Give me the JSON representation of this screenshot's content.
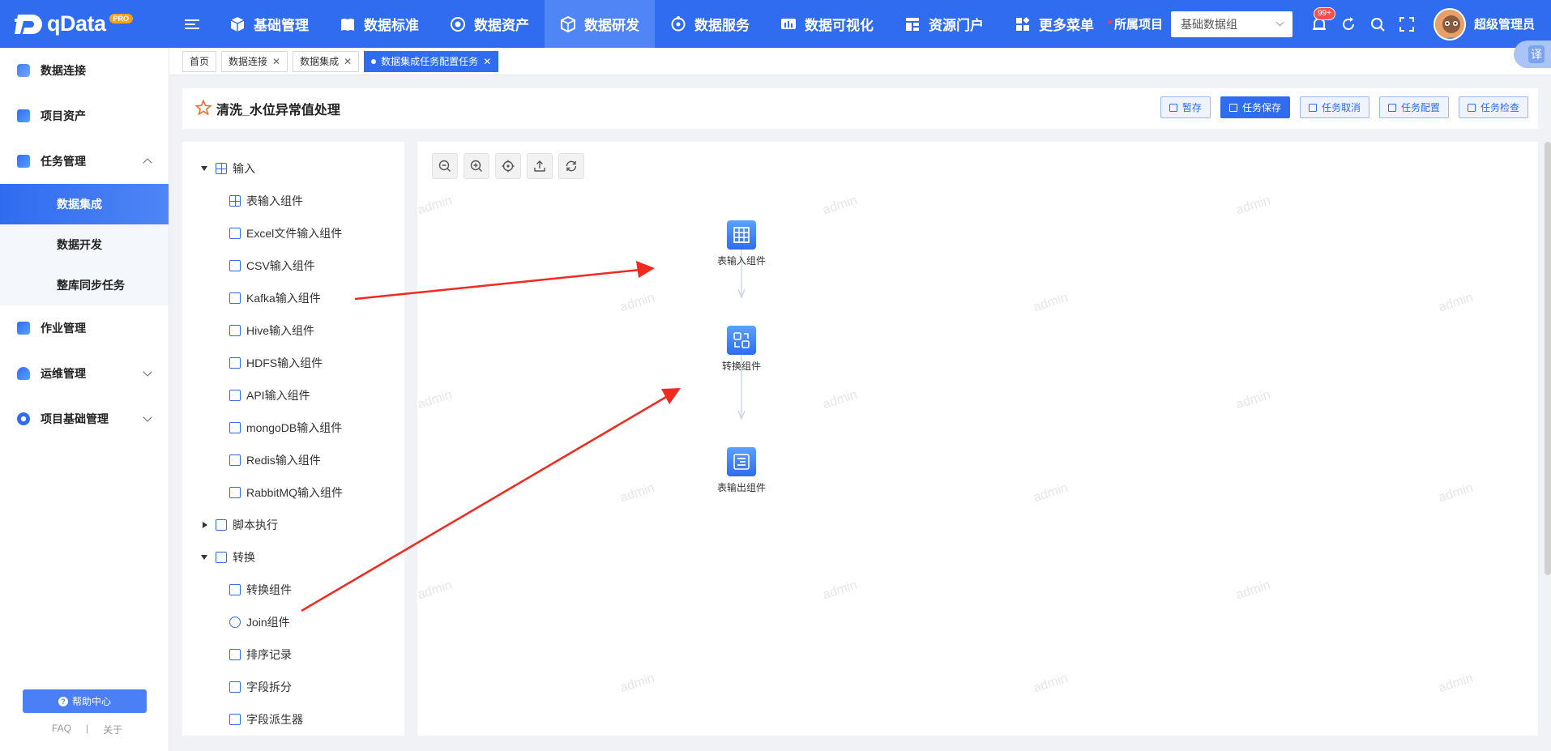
{
  "brand": {
    "name": "qData",
    "tag": "PRO"
  },
  "topnav": {
    "items": [
      {
        "label": "基础管理",
        "icon": "cube-icon"
      },
      {
        "label": "数据标准",
        "icon": "book-icon"
      },
      {
        "label": "数据资产",
        "icon": "target-icon"
      },
      {
        "label": "数据研发",
        "icon": "box-icon",
        "active": true
      },
      {
        "label": "数据服务",
        "icon": "service-icon"
      },
      {
        "label": "数据可视化",
        "icon": "chart-icon"
      },
      {
        "label": "资源门户",
        "icon": "portal-icon"
      },
      {
        "label": "更多菜单",
        "icon": "apps-icon"
      }
    ],
    "project_label": "所属项目",
    "project_value": "基础数据组",
    "notification_count": "99+",
    "user_name": "超级管理员"
  },
  "sidebar": {
    "items": [
      {
        "label": "数据连接"
      },
      {
        "label": "项目资产"
      },
      {
        "label": "任务管理"
      },
      {
        "label": "作业管理"
      },
      {
        "label": "运维管理"
      },
      {
        "label": "项目基础管理"
      }
    ],
    "sub_items": [
      {
        "label": "数据集成",
        "active": true
      },
      {
        "label": "数据开发"
      },
      {
        "label": "整库同步任务"
      }
    ],
    "help_label": "帮助中心",
    "faq_label": "FAQ",
    "about_label": "关于"
  },
  "tabs": [
    {
      "label": "首页",
      "closable": false
    },
    {
      "label": "数据连接",
      "closable": true
    },
    {
      "label": "数据集成",
      "closable": true
    },
    {
      "label": "数据集成任务配置任务",
      "closable": true,
      "active": true
    }
  ],
  "translate_label": "译",
  "task": {
    "title": "清洗_水位异常值处理",
    "actions": [
      "暂存",
      "任务保存",
      "任务取消",
      "任务配置",
      "任务检查"
    ]
  },
  "component_tree": {
    "input_group": "输入",
    "input_items": [
      "表输入组件",
      "Excel文件输入组件",
      "CSV输入组件",
      "Kafka输入组件",
      "Hive输入组件",
      "HDFS输入组件",
      "API输入组件",
      "mongoDB输入组件",
      "Redis输入组件",
      "RabbitMQ输入组件"
    ],
    "script_group": "脚本执行",
    "transform_group": "转换",
    "transform_items": [
      "转换组件",
      "Join组件",
      "排序记录",
      "字段拆分",
      "字段派生器"
    ]
  },
  "canvas": {
    "watermark": "admin",
    "nodes": [
      {
        "label": "表输入组件",
        "icon": "table-icon"
      },
      {
        "label": "转换组件",
        "icon": "transform-icon"
      },
      {
        "label": "表输出组件",
        "icon": "output-icon"
      }
    ]
  },
  "colors": {
    "primary": "#2f6cf0",
    "annotation_arrow": "#f02a1e"
  }
}
